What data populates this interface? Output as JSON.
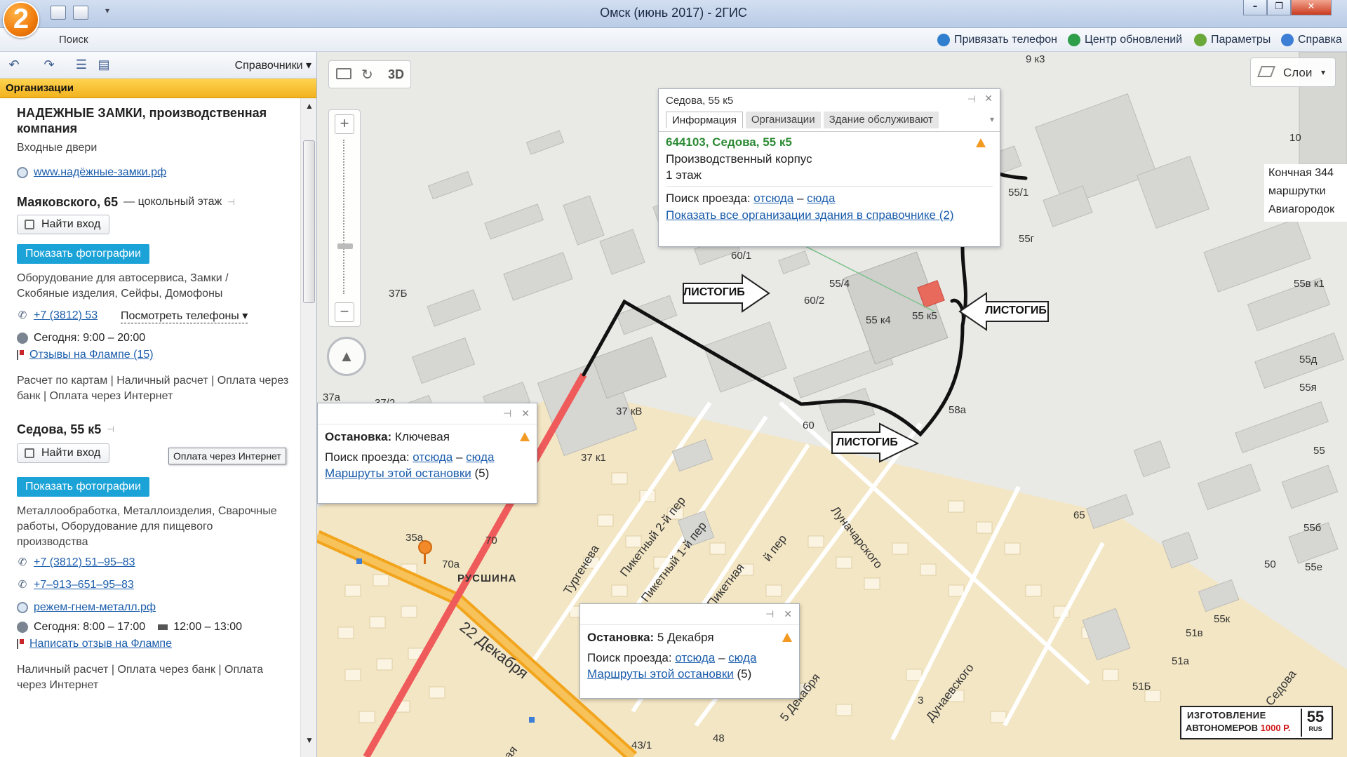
{
  "window": {
    "title": "Омск (июнь 2017) - 2ГИС",
    "logo_text": "2",
    "min": "–",
    "max": "❐",
    "close": "✕"
  },
  "menu": {
    "search_tab": "Поиск",
    "links": [
      "Привязать телефон",
      "Центр обновлений",
      "Параметры",
      "Справка"
    ]
  },
  "left_toolbar": {
    "directories": "Справочники"
  },
  "left_header": "Организации",
  "org1": {
    "name": "НАДЕЖНЫЕ ЗАМКИ, производственная компания",
    "subtitle": "Входные двери",
    "website": "www.надёжные-замки.рф",
    "address": "Маяковского, 65",
    "address_note": "— цокольный этаж",
    "find_entrance": "Найти вход",
    "show_photos": "Показать фотографии",
    "categories": "Оборудование для автосервиса, Замки / Скобяные изделия, Сейфы, Домофоны",
    "phone": "+7 (3812) 53",
    "view_phones": "Посмотреть телефоны",
    "hours": "Сегодня: 9:00 – 20:00",
    "reviews": "Отзывы на Флампе (15)",
    "payment": "Расчет по картам | Наличный расчет | Оплата через банк | Оплата через Интернет"
  },
  "org2": {
    "address": "Седова, 55 к5",
    "tooltip": "Оплата через Интернет",
    "find_entrance": "Найти вход",
    "show_photos": "Показать фотографии",
    "categories": "Металлообработка, Металлоизделия, Сварочные работы, Оборудование для пищевого производства",
    "phone1": "+7 (3812) 51–95–83",
    "phone2": "+7–913–651–95–83",
    "website": "режем-гнем-металл.рф",
    "hours": "Сегодня: 8:00 – 17:00",
    "break": "12:00 – 13:00",
    "review": "Написать отзыв на Флампе",
    "payment": "Наличный расчет | Оплата через банк | Оплата через Интернет"
  },
  "map_controls": {
    "mode_3d": "3D",
    "layers": "Слои"
  },
  "popup_building": {
    "title": "Седова, 55 к5",
    "tabs": [
      "Информация",
      "Организации",
      "Здание обслуживают"
    ],
    "address": "644103, Седова, 55 к5",
    "type": "Производственный корпус",
    "floors": "1 этаж",
    "route_label": "Поиск проезда:",
    "from": "отсюда",
    "dash": "–",
    "to": "сюда",
    "all_orgs": "Показать все организации здания в справочнике (2)"
  },
  "popup_stop1": {
    "label": "Остановка:",
    "name": "Ключевая",
    "route_label": "Поиск проезда:",
    "from": "отсюда",
    "dash": "–",
    "to": "сюда",
    "routes": "Маршруты этой остановки",
    "routes_count": "(5)"
  },
  "popup_stop2": {
    "label": "Остановка:",
    "name": "5 Декабря",
    "route_label": "Поиск проезда:",
    "from": "отсюда",
    "dash": "–",
    "to": "сюда",
    "routes": "Маршруты этой остановки",
    "routes_count": "(5)"
  },
  "callouts": {
    "c1": "ЛИСТОГИБ",
    "c2": "ЛИСТОГИБ",
    "c3": "ЛИСТОГИБ"
  },
  "map_note": [
    "Кончная 344",
    "маршрутки",
    "Авиагородок"
  ],
  "ad": {
    "line1": "ИЗГОТОВЛЕНИЕ",
    "line2": "АВТОНОМЕРОВ",
    "price": "1000 Р.",
    "number": "55",
    "rus": "RUS"
  },
  "map_labels": {
    "l9k3": "9 к3",
    "l10": "10",
    "l551": "55/1",
    "l55g": "55г",
    "l55v1": "55в к1",
    "l554": "55/4",
    "l55k4": "55 к4",
    "l55k5": "55 к5",
    "l55d": "55д",
    "l55ya": "55я",
    "l55": "55",
    "l55b": "55б",
    "l50": "50",
    "l55e": "55е",
    "l55k": "55к",
    "l51v": "51в",
    "l51a": "51а",
    "l51b": "51Б",
    "l601": "60/1",
    "l602": "60/2",
    "l37b": "37Б",
    "l37a": "37а",
    "l372": "37/2",
    "l37kv": "37 кВ",
    "l37k1": "37 к1",
    "l58a": "58а",
    "l60": "60",
    "l65": "65",
    "l35a": "35а",
    "l70": "70",
    "l70a": "70а",
    "l431": "43/1",
    "l48": "48",
    "l3": "3",
    "russhina": "РУСШИНА"
  },
  "streets": {
    "turgeneva": "Тургенева",
    "dec22": "22 Декабря",
    "piket2": "Пикетный 2-й пер",
    "piket1": "Пикетный 1-й пер",
    "piketnaya": "Пикетная",
    "lunach": "Луначарского",
    "dunaev": "Дунаевского",
    "dec5": "5 Декабря",
    "sedova": "Седова",
    "per": "й пер",
    "tnaya": "тная"
  },
  "colors": {
    "route_red": "#ef5a5a",
    "road_orange": "#f2a51c",
    "link_blue": "#1b5dab",
    "header_yellow": "#f2b21d",
    "photo_button": "#1ba3d8"
  }
}
